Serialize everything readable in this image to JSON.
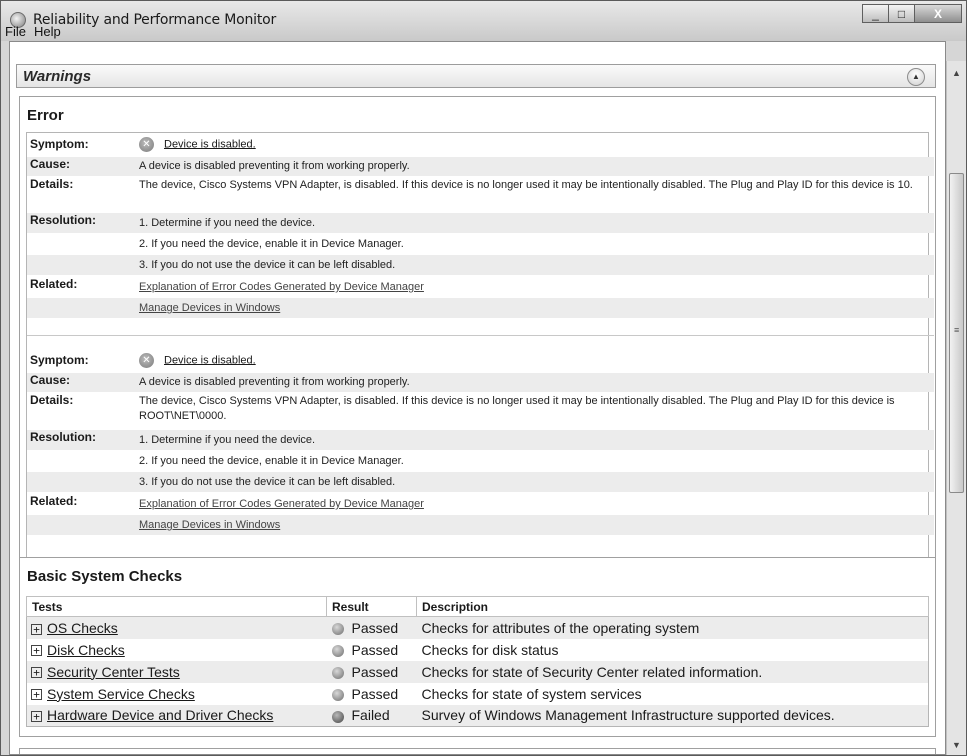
{
  "window": {
    "title": "Reliability and Performance Monitor",
    "minimize_glyph": "_",
    "maximize_glyph": "□",
    "close_glyph": "X"
  },
  "menu": [
    "File",
    "Help"
  ],
  "warnings": {
    "title": "Warnings",
    "collapse_icon": "up-chevron-icon",
    "collapse_glyph": "▲"
  },
  "error": {
    "heading": "Error",
    "labels": {
      "symptom": "Symptom:",
      "cause": "Cause:",
      "details": "Details:",
      "resolution": "Resolution:",
      "related": "Related:"
    },
    "error_glyph": "✕",
    "entries": [
      {
        "symptom": "Device is disabled.",
        "cause": "A device is disabled preventing it from working properly.",
        "details": "The device, Cisco Systems VPN Adapter, is disabled. If this device is no longer used it may be intentionally disabled. The Plug and Play ID for this device is 10.",
        "resolution": [
          "1. Determine if you need the device.",
          "2. If you need the device, enable it in Device Manager.",
          "3. If you do not use the device it can be left disabled."
        ],
        "related": [
          "Explanation of Error Codes Generated by Device Manager",
          "Manage Devices in Windows"
        ]
      },
      {
        "symptom": "Device is disabled.",
        "cause": "A device is disabled preventing it from working properly.",
        "details": "The device, Cisco Systems VPN Adapter, is disabled. If this device is no longer used it may be intentionally disabled. The Plug and Play ID for this device is ROOT\\NET\\0000.",
        "resolution": [
          "1. Determine if you need the device.",
          "2. If you need the device, enable it in Device Manager.",
          "3. If you do not use the device it can be left disabled."
        ],
        "related": [
          "Explanation of Error Codes Generated by Device Manager",
          "Manage Devices in Windows"
        ]
      }
    ]
  },
  "checks": {
    "heading": "Basic System Checks",
    "columns": [
      "Tests",
      "Result",
      "Description"
    ],
    "expand_glyph": "+",
    "rows": [
      {
        "test": "OS Checks",
        "result": "Passed",
        "description": "Checks for attributes of the operating system"
      },
      {
        "test": "Disk Checks",
        "result": "Passed",
        "description": "Checks for disk status"
      },
      {
        "test": "Security Center Tests",
        "result": "Passed",
        "description": "Checks for state of Security Center related information."
      },
      {
        "test": "System Service Checks",
        "result": "Passed",
        "description": "Checks for state of system services"
      },
      {
        "test": "Hardware Device and Driver Checks",
        "result": "Failed",
        "description": "Survey of Windows Management Infrastructure supported devices."
      }
    ]
  },
  "scrollbar": {
    "up_glyph": "▲",
    "down_glyph": "▼",
    "grip_glyph": "≡"
  }
}
